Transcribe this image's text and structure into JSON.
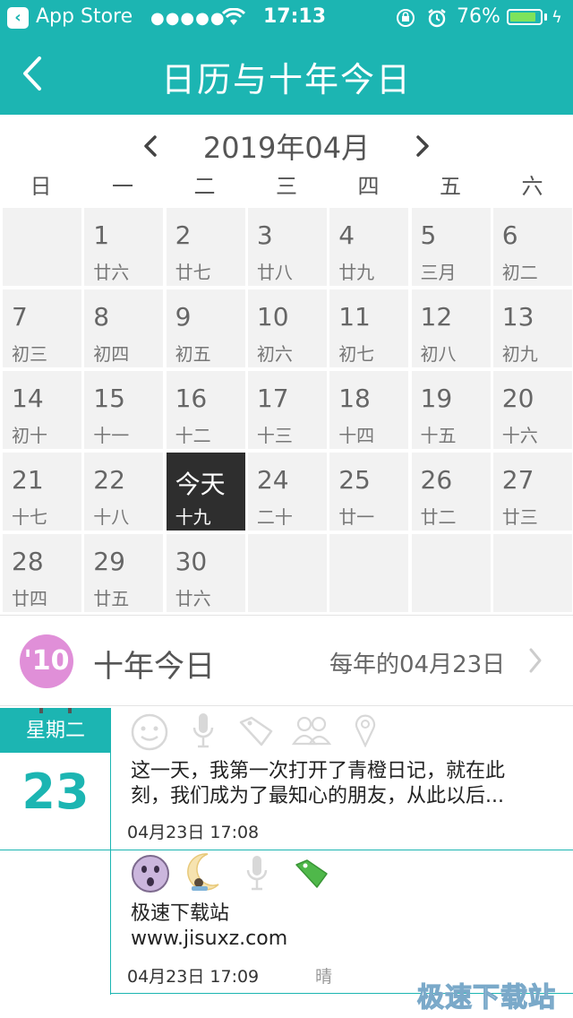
{
  "status_bar": {
    "back_app": "App Store",
    "signal": "●●●●●",
    "time": "17:13",
    "battery": "76%"
  },
  "header": {
    "title": "日历与十年今日"
  },
  "calendar": {
    "month_label": "2019年04月",
    "weekdays": [
      "日",
      "一",
      "二",
      "三",
      "四",
      "五",
      "六"
    ],
    "days": [
      {
        "num": "1",
        "lunar": "廿六"
      },
      {
        "num": "2",
        "lunar": "廿七"
      },
      {
        "num": "3",
        "lunar": "廿八"
      },
      {
        "num": "4",
        "lunar": "廿九"
      },
      {
        "num": "5",
        "lunar": "三月"
      },
      {
        "num": "6",
        "lunar": "初二"
      },
      {
        "num": "7",
        "lunar": "初三"
      },
      {
        "num": "8",
        "lunar": "初四"
      },
      {
        "num": "9",
        "lunar": "初五"
      },
      {
        "num": "10",
        "lunar": "初六"
      },
      {
        "num": "11",
        "lunar": "初七"
      },
      {
        "num": "12",
        "lunar": "初八"
      },
      {
        "num": "13",
        "lunar": "初九"
      },
      {
        "num": "14",
        "lunar": "初十"
      },
      {
        "num": "15",
        "lunar": "十一"
      },
      {
        "num": "16",
        "lunar": "十二"
      },
      {
        "num": "17",
        "lunar": "十三"
      },
      {
        "num": "18",
        "lunar": "十四"
      },
      {
        "num": "19",
        "lunar": "十五"
      },
      {
        "num": "20",
        "lunar": "十六"
      },
      {
        "num": "21",
        "lunar": "十七"
      },
      {
        "num": "22",
        "lunar": "十八"
      },
      {
        "num": "今天",
        "lunar": "十九"
      },
      {
        "num": "24",
        "lunar": "二十"
      },
      {
        "num": "25",
        "lunar": "廿一"
      },
      {
        "num": "26",
        "lunar": "廿二"
      },
      {
        "num": "27",
        "lunar": "廿三"
      },
      {
        "num": "28",
        "lunar": "廿四"
      },
      {
        "num": "29",
        "lunar": "廿五"
      },
      {
        "num": "30",
        "lunar": "廿六"
      }
    ]
  },
  "ten_years": {
    "badge": "'10",
    "title": "十年今日",
    "date_label": "每年的04月23日"
  },
  "day": {
    "weekday": "星期二",
    "number": "23"
  },
  "entries": [
    {
      "text_line1": "这一天，我第一次打开了青橙日记，就在此",
      "text_line2": "刻，我们成为了最知心的朋友，从此以后...",
      "time": "04月23日 17:08"
    },
    {
      "text_line1": "极速下载站",
      "text_line2": "www.jisuxz.com",
      "time": "04月23日 17:09",
      "weather": "晴"
    }
  ],
  "watermark": "极速下载站",
  "colors": {
    "accent": "#1cb5b2",
    "today_bg": "#2e2e2e",
    "cell_bg": "#f2f2f2"
  }
}
